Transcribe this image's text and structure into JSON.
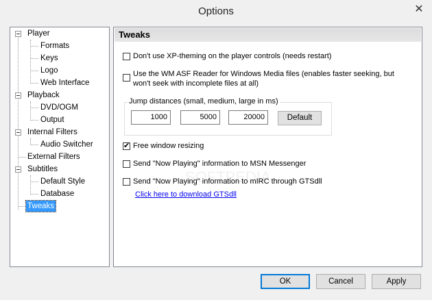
{
  "window": {
    "title": "Options",
    "close_glyph": "✕"
  },
  "tree": {
    "items": [
      {
        "label": "Player",
        "expanded": true
      },
      {
        "label": "Formats"
      },
      {
        "label": "Keys"
      },
      {
        "label": "Logo"
      },
      {
        "label": "Web Interface"
      },
      {
        "label": "Playback",
        "expanded": true
      },
      {
        "label": "DVD/OGM"
      },
      {
        "label": "Output"
      },
      {
        "label": "Internal Filters",
        "expanded": true
      },
      {
        "label": "Audio Switcher"
      },
      {
        "label": "External Filters"
      },
      {
        "label": "Subtitles",
        "expanded": true
      },
      {
        "label": "Default Style"
      },
      {
        "label": "Database"
      },
      {
        "label": "Tweaks",
        "selected": true
      }
    ]
  },
  "panel": {
    "title": "Tweaks",
    "options": {
      "xp_theming": {
        "label": "Don't use XP-theming on the player controls (needs restart)",
        "checked": false
      },
      "wm_asf_line1": "Use the WM ASF Reader for Windows Media files (enables faster seeking, but",
      "wm_asf_line2": "won't seek with incomplete files at all)",
      "wm_asf_checked": false,
      "free_resize": {
        "label": "Free window resizing",
        "checked": true
      },
      "msn": {
        "label": "Send \"Now Playing\" information to MSN Messenger",
        "checked": false
      },
      "mirc": {
        "label": "Send \"Now Playing\" information to mIRC through GTSdll",
        "checked": false
      }
    },
    "jump": {
      "label": "Jump distances (small, medium, large in ms)",
      "small": "1000",
      "medium": "5000",
      "large": "20000",
      "default_label": "Default"
    },
    "download_link": "Click here to download GTSdll"
  },
  "buttons": {
    "ok": "OK",
    "cancel": "Cancel",
    "apply": "Apply"
  },
  "watermark": "SOFTPEDIA"
}
